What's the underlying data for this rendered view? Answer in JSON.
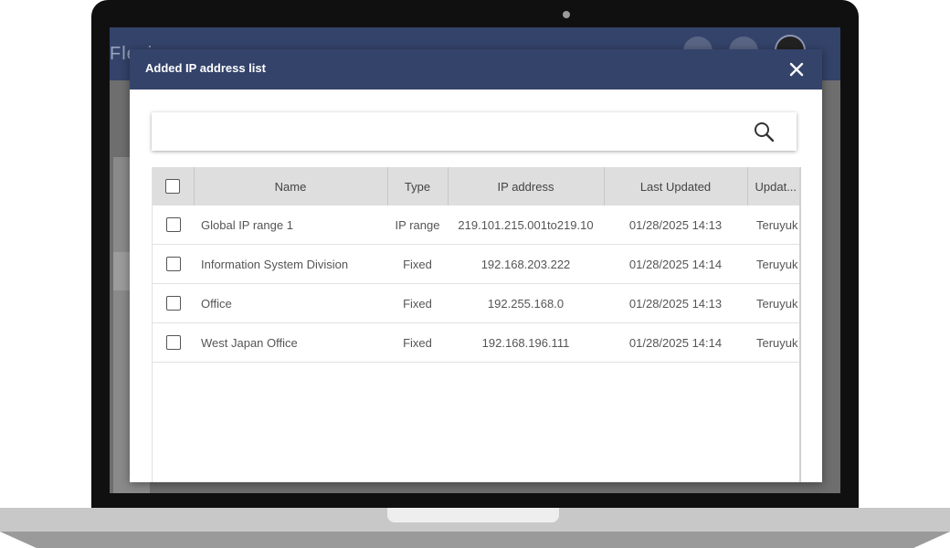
{
  "app": {
    "logo_text": "Flexi..."
  },
  "modal": {
    "title": "Added IP address list",
    "close_icon": "close-icon"
  },
  "search": {
    "value": "",
    "placeholder": "",
    "icon": "search-icon"
  },
  "table": {
    "columns": [
      "Name",
      "Type",
      "IP address",
      "Last Updated",
      "Updat..."
    ],
    "rows": [
      {
        "name": "Global IP range 1",
        "type": "IP range",
        "ip": "219.101.215.001to219.10",
        "updated": "01/28/2025 14:13",
        "by": "Teruyuk"
      },
      {
        "name": "Information System Division",
        "type": "Fixed",
        "ip": "192.168.203.222",
        "updated": "01/28/2025 14:14",
        "by": "Teruyuk"
      },
      {
        "name": "Office",
        "type": "Fixed",
        "ip": "192.255.168.0",
        "updated": "01/28/2025 14:13",
        "by": "Teruyuk"
      },
      {
        "name": "West Japan Office",
        "type": "Fixed",
        "ip": "192.168.196.111",
        "updated": "01/28/2025 14:14",
        "by": "Teruyuk"
      }
    ]
  },
  "colors": {
    "header_bg": "#34436a",
    "table_header_bg": "#dedede",
    "laptop_frame": "#101010"
  }
}
